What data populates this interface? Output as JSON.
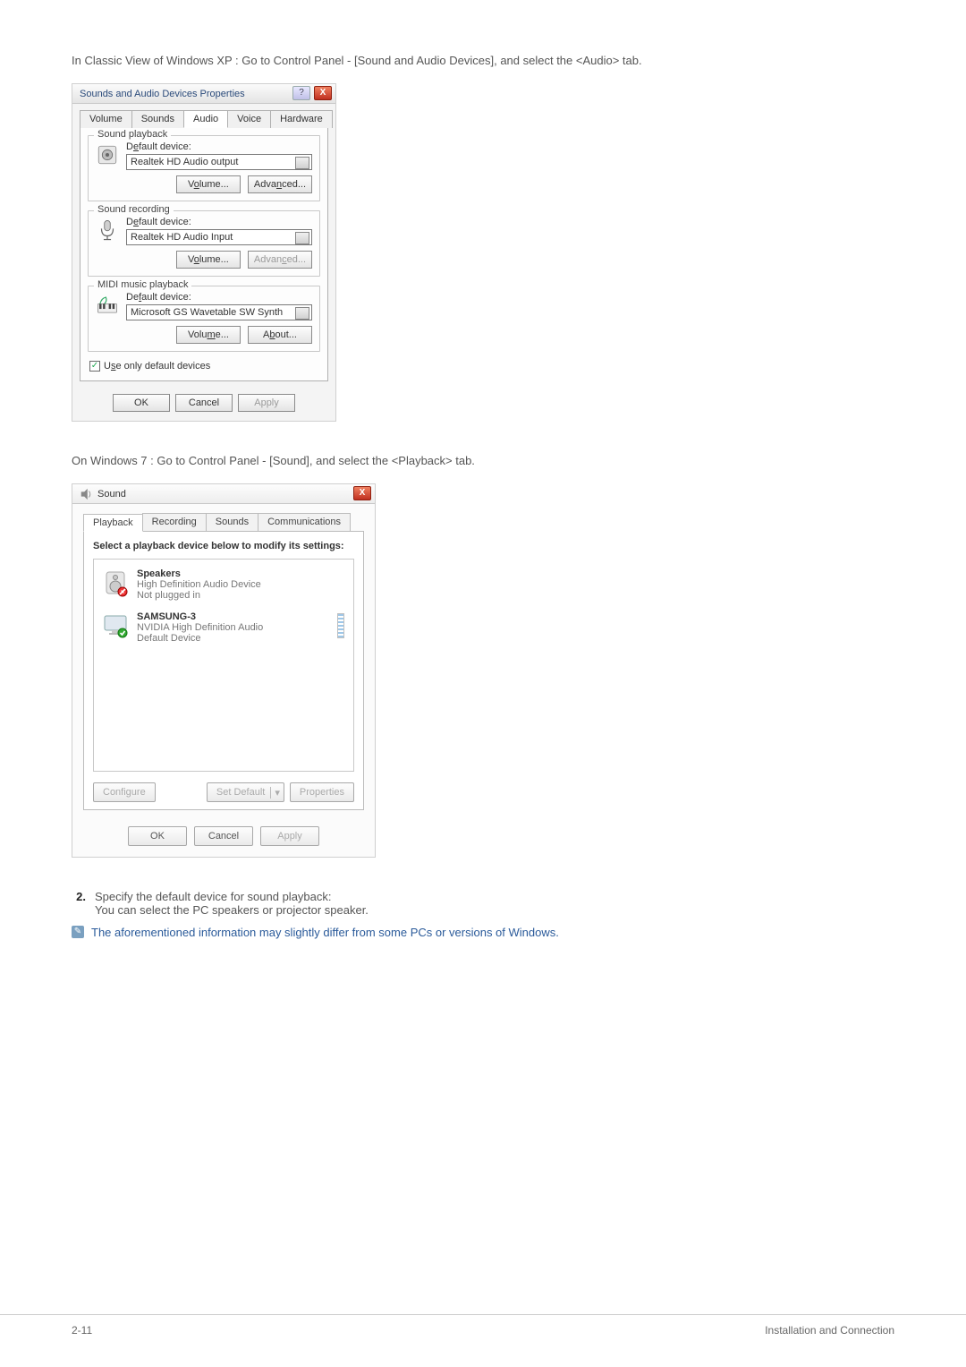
{
  "intro_xp": "In Classic View of Windows XP : Go to Control Panel - [Sound and Audio Devices], and select the <Audio> tab.",
  "xp_dialog": {
    "title": "Sounds and Audio Devices Properties",
    "help_glyph": "?",
    "close_glyph": "X",
    "tabs": {
      "volume": "Volume",
      "sounds": "Sounds",
      "audio": "Audio",
      "voice": "Voice",
      "hardware": "Hardware"
    },
    "groups": {
      "playback": {
        "legend": "Sound playback",
        "label_pre": "D",
        "label_ul": "e",
        "label_post": "fault device:",
        "device": "Realtek HD Audio output",
        "volume_btn": "Volume...",
        "volume_pre": "V",
        "volume_ul": "o",
        "volume_post": "lume...",
        "adv_pre": "Adva",
        "adv_ul": "n",
        "adv_post": "ced..."
      },
      "recording": {
        "legend": "Sound recording",
        "label_pre": "D",
        "label_ul": "e",
        "label_post": "fault device:",
        "device": "Realtek HD Audio Input",
        "volume_pre": "V",
        "volume_ul": "o",
        "volume_post": "lume...",
        "adv_pre": "Advan",
        "adv_ul": "c",
        "adv_post": "ed..."
      },
      "midi": {
        "legend": "MIDI music playback",
        "label_pre": "De",
        "label_ul": "f",
        "label_post": "ault device:",
        "device": "Microsoft GS Wavetable SW Synth",
        "volume_pre": "Volu",
        "volume_ul": "m",
        "volume_post": "e...",
        "about_pre": "A",
        "about_ul": "b",
        "about_post": "out..."
      }
    },
    "checkbox_pre": "U",
    "checkbox_ul": "s",
    "checkbox_post": "e only default devices",
    "ok": "OK",
    "cancel": "Cancel",
    "apply": "Apply"
  },
  "intro_win7": "On Windows 7 : Go to Control Panel - [Sound], and select the <Playback> tab.",
  "win7_dialog": {
    "title": "Sound",
    "close_glyph": "X",
    "tabs": {
      "playback": "Playback",
      "recording": "Recording",
      "sounds": "Sounds",
      "communications": "Communications"
    },
    "hint": "Select a playback device below to modify its settings:",
    "devices": [
      {
        "name": "Speakers",
        "sub": "High Definition Audio Device",
        "status": "Not plugged in"
      },
      {
        "name": "SAMSUNG-3",
        "sub": "NVIDIA High Definition Audio",
        "status": "Default Device"
      }
    ],
    "configure": "Configure",
    "set_default": "Set Default",
    "caret": "▾",
    "properties": "Properties",
    "ok": "OK",
    "cancel": "Cancel",
    "apply": "Apply"
  },
  "step2": {
    "num": "2.",
    "line1": "Specify the default device for sound playback:",
    "line2": "You can select the PC speakers or projector speaker."
  },
  "note_text": "The aforementioned information may slightly differ from some PCs or versions of Windows.",
  "footer": {
    "left": "2-11",
    "right": "Installation and Connection"
  }
}
